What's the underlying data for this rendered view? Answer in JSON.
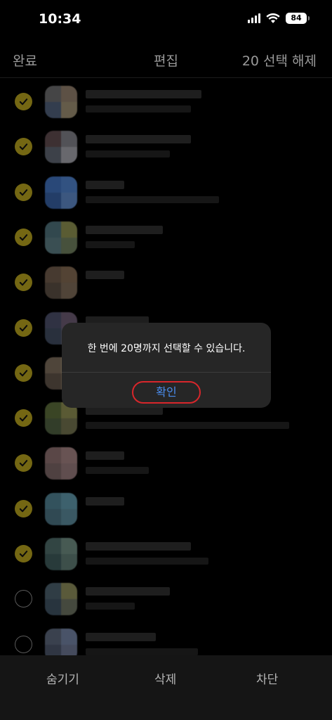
{
  "status": {
    "time": "10:34",
    "battery": "84"
  },
  "nav": {
    "left": "완료",
    "title": "편집",
    "right": "20 선택 해제"
  },
  "rows": [
    {
      "checked": true,
      "avatar": [
        "#6b6a6c",
        "#8f7d6a",
        "#4f5e78",
        "#9a8d70"
      ]
    },
    {
      "checked": true,
      "avatar": [
        "#5e4a4e",
        "#7f7f86",
        "#5f6570",
        "#a0a0a8"
      ]
    },
    {
      "checked": true,
      "avatar": [
        "#3f6fb8",
        "#4d7fc7",
        "#365f9e",
        "#5c86c4"
      ]
    },
    {
      "checked": true,
      "avatar": [
        "#4d6f78",
        "#8a8e4f",
        "#5a7a80",
        "#6e7d5c"
      ]
    },
    {
      "checked": true,
      "avatar": [
        "#6e5a4a",
        "#806850",
        "#5a4d42",
        "#7b6957"
      ]
    },
    {
      "checked": true,
      "avatar": [
        "#4a4e68",
        "#6a5a70",
        "#3f4a5e",
        "#5e5e70"
      ]
    },
    {
      "checked": true,
      "avatar": [
        "#7a6a5a",
        "#9a8a70",
        "#5e5248",
        "#85745f"
      ]
    },
    {
      "checked": true,
      "avatar": [
        "#5a6a3a",
        "#8a8a50",
        "#4e5e40",
        "#70704e"
      ]
    },
    {
      "checked": true,
      "avatar": [
        "#8a6e6e",
        "#a08080",
        "#7a6464",
        "#94787a"
      ]
    },
    {
      "checked": true,
      "avatar": [
        "#4f7f90",
        "#5f96a8",
        "#4a7080",
        "#5a8898"
      ]
    },
    {
      "checked": true,
      "avatar": [
        "#4e6a68",
        "#6e8a80",
        "#3e5a5a",
        "#5e7a72"
      ]
    },
    {
      "checked": false,
      "avatar": [
        "#4a5e6a",
        "#8a8a5a",
        "#3e5060",
        "#6a7060"
      ]
    },
    {
      "checked": false,
      "avatar": [
        "#5a6478",
        "#7080a0",
        "#4a5468",
        "#6a7490"
      ]
    }
  ],
  "alert": {
    "message": "한 번에 20명까지 선택할 수 있습니다.",
    "button": "확인"
  },
  "bottom": {
    "hide": "숨기기",
    "delete": "삭제",
    "block": "차단"
  }
}
